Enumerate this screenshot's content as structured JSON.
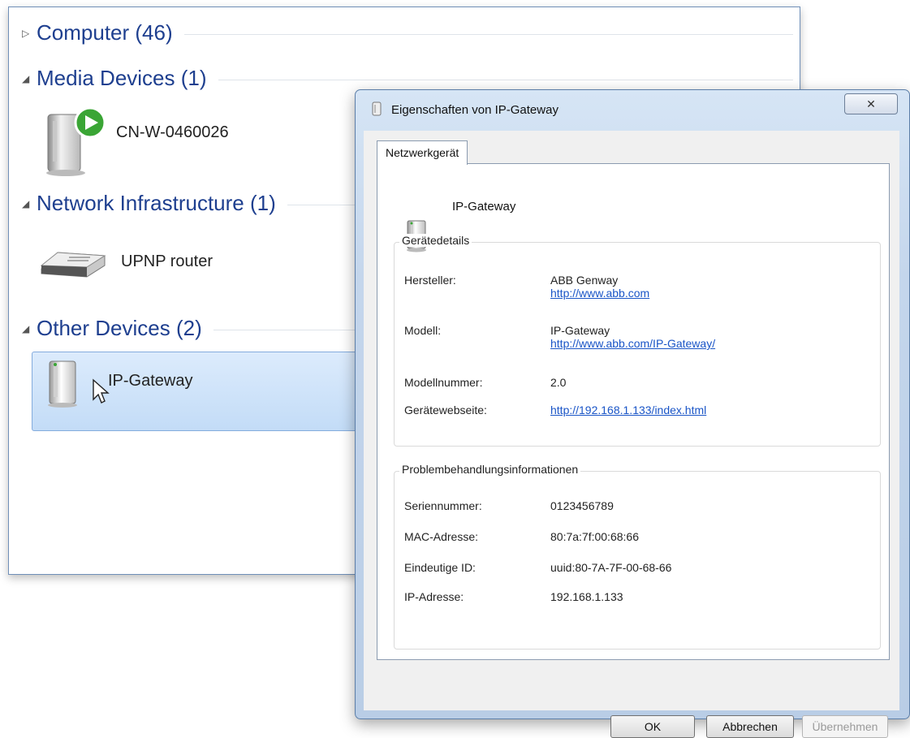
{
  "explorer": {
    "groups": [
      {
        "label": "Computer (46)",
        "expanded": false
      },
      {
        "label": "Media Devices (1)",
        "expanded": true
      },
      {
        "label": "Network Infrastructure (1)",
        "expanded": true
      },
      {
        "label": "Other Devices (2)",
        "expanded": true
      }
    ],
    "items": {
      "media": "CN-W-0460026",
      "router": "UPNP router",
      "gateway": "IP-Gateway"
    }
  },
  "dialog": {
    "title": "Eigenschaften von IP-Gateway",
    "tab": "Netzwerkgerät",
    "device_name": "IP-Gateway",
    "details": {
      "legend": "Gerätedetails",
      "hersteller_label": "Hersteller:",
      "hersteller_value": "ABB Genway",
      "hersteller_link": "http://www.abb.com",
      "modell_label": "Modell:",
      "modell_value": "IP-Gateway",
      "modell_link": "http://www.abb.com/IP-Gateway/",
      "modellnummer_label": "Modellnummer:",
      "modellnummer_value": "2.0",
      "webseite_label": "Gerätewebseite:",
      "webseite_link": "http://192.168.1.133/index.html"
    },
    "troubleshoot": {
      "legend": "Problembehandlungsinformationen",
      "serial_label": "Seriennummer:",
      "serial_value": "0123456789",
      "mac_label": "MAC-Adresse:",
      "mac_value": "80:7a:7f:00:68:66",
      "uid_label": "Eindeutige ID:",
      "uid_value": "uuid:80-7A-7F-00-68-66",
      "ip_label": "IP-Adresse:",
      "ip_value": "192.168.1.133"
    },
    "buttons": {
      "ok": "OK",
      "cancel": "Abbrechen",
      "apply": "Übernehmen"
    }
  }
}
